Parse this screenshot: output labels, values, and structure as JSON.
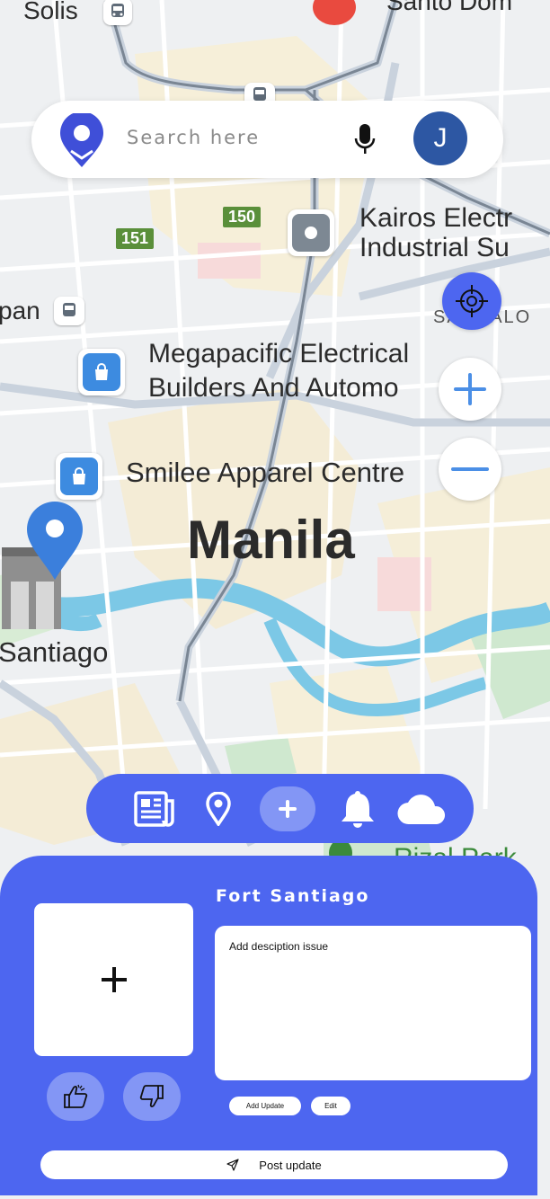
{
  "search": {
    "placeholder": "Search here",
    "avatar_initial": "J"
  },
  "map": {
    "city_label": "Manila",
    "place_labels": {
      "solis": "Solis",
      "santo": "Santo Dom",
      "kairos_1": "Kairos Electr",
      "kairos_2": "Industrial Su",
      "pan": "pan",
      "sampaloc": "SAMPALO",
      "megapacific_1": "Megapacific Electrical",
      "megapacific_2": "Builders And Automo",
      "megapacific_ellipsis": "...",
      "smilee": "Smilee Apparel Centre",
      "santiago": "Santiago",
      "rizal": "Rizal Park"
    },
    "road_shields": [
      "150",
      "151"
    ]
  },
  "bottom_nav": {
    "items": [
      "news-icon",
      "location-pin-icon",
      "add-icon",
      "bell-icon",
      "cloud-icon"
    ]
  },
  "panel": {
    "title": "Fort Santiago",
    "description_placeholder": "Add desciption issue",
    "add_update_label": "Add Update",
    "edit_label": "Edit",
    "post_update_label": "Post update"
  },
  "colors": {
    "accent": "#4d66f0",
    "accent_light": "#8396f5",
    "avatar": "#2d57a3",
    "road_shield": "#5a8f3a"
  }
}
